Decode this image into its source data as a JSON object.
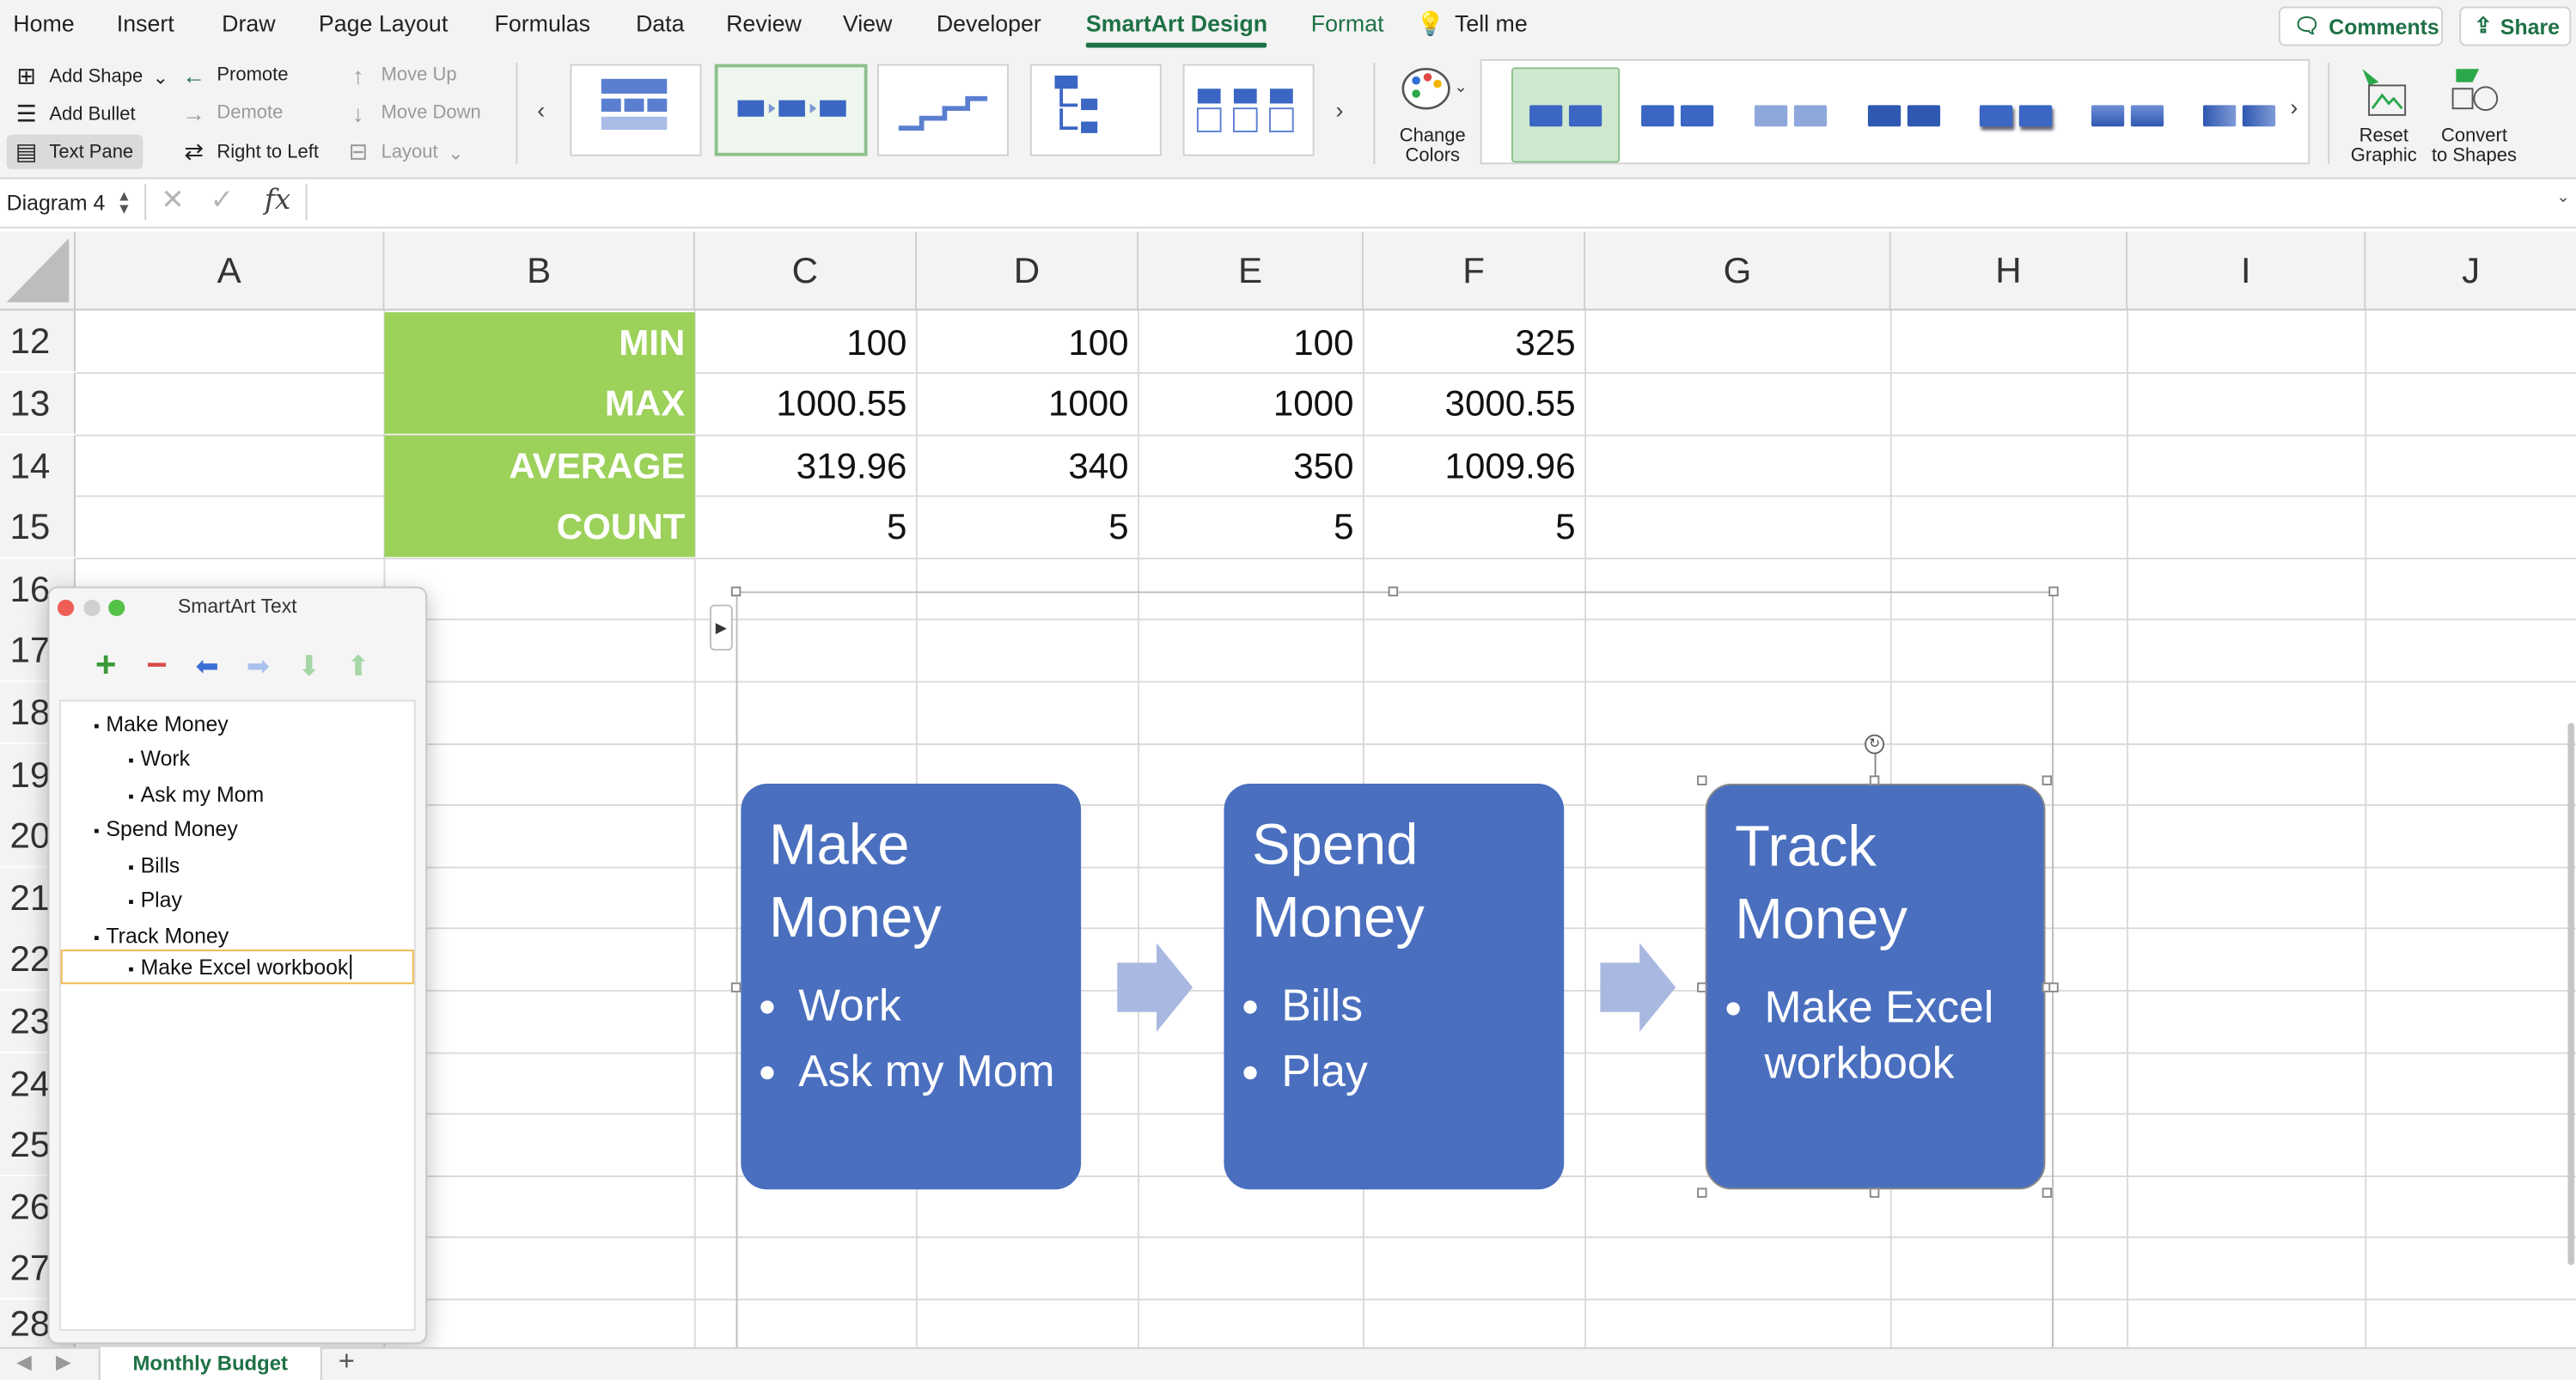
{
  "tabs": [
    "Home",
    "Insert",
    "Draw",
    "Page Layout",
    "Formulas",
    "Data",
    "Review",
    "View",
    "Developer",
    "SmartArt Design",
    "Format",
    "Tell me"
  ],
  "active_tab": "SmartArt Design",
  "comments_label": "Comments",
  "share_label": "Share",
  "ribbon": {
    "add_shape": "Add Shape",
    "add_bullet": "Add Bullet",
    "text_pane": "Text Pane",
    "promote": "Promote",
    "demote": "Demote",
    "right_to_left": "Right to Left",
    "move_up": "Move Up",
    "move_down": "Move Down",
    "layout": "Layout",
    "change_colors_1": "Change",
    "change_colors_2": "Colors",
    "reset_1": "Reset",
    "reset_2": "Graphic",
    "convert_1": "Convert",
    "convert_2": "to Shapes"
  },
  "formula_bar": {
    "name_box": "Diagram 4",
    "fx": "fx"
  },
  "columns": [
    "A",
    "B",
    "C",
    "D",
    "E",
    "F",
    "G",
    "H",
    "I",
    "J"
  ],
  "rows": [
    {
      "n": "12",
      "label": "MIN",
      "values": [
        "100",
        "100",
        "100",
        "325"
      ]
    },
    {
      "n": "13",
      "label": "MAX",
      "values": [
        "1000.55",
        "1000",
        "1000",
        "3000.55"
      ]
    },
    {
      "n": "14",
      "label": "AVERAGE",
      "values": [
        "319.96",
        "340",
        "350",
        "1009.96"
      ]
    },
    {
      "n": "15",
      "label": "COUNT",
      "values": [
        "5",
        "5",
        "5",
        "5"
      ]
    }
  ],
  "empty_rows": [
    "16",
    "17",
    "18",
    "19",
    "20",
    "21",
    "22",
    "23",
    "24",
    "25",
    "26",
    "27",
    "28"
  ],
  "smartart": [
    {
      "title": [
        "Make",
        "Money"
      ],
      "bullets": [
        "Work",
        "Ask my Mom"
      ]
    },
    {
      "title": [
        "Spend",
        "Money"
      ],
      "bullets": [
        "Bills",
        "Play"
      ]
    },
    {
      "title": [
        "Track",
        "Money"
      ],
      "bullets": [
        "Make Excel workbook"
      ]
    }
  ],
  "text_pane": {
    "title": "SmartArt Text",
    "items": [
      {
        "level": 1,
        "text": "Make Money"
      },
      {
        "level": 2,
        "text": "Work"
      },
      {
        "level": 2,
        "text": "Ask my Mom"
      },
      {
        "level": 1,
        "text": "Spend Money"
      },
      {
        "level": 2,
        "text": "Bills"
      },
      {
        "level": 2,
        "text": "Play"
      },
      {
        "level": 1,
        "text": "Track Money"
      },
      {
        "level": 2,
        "text": "Make Excel workbook"
      }
    ]
  },
  "sheet_tab": "Monthly Budget",
  "colors": {
    "accent": "#1e7145",
    "label_fill": "#9cd15a",
    "box_fill": "#4a6fbf"
  }
}
